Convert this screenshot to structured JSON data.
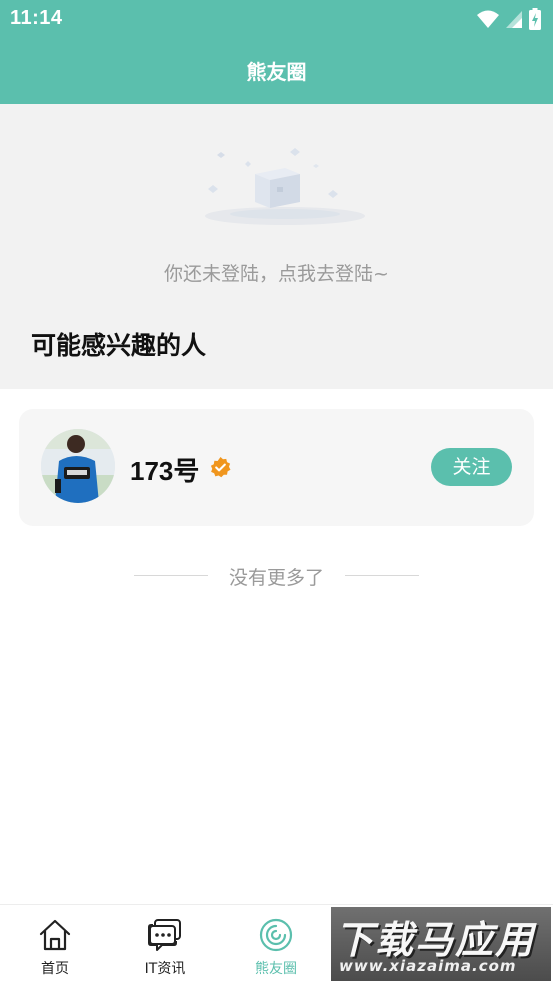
{
  "status_bar": {
    "time": "11:14"
  },
  "app_bar": {
    "title": "熊友圈"
  },
  "login_prompt": "你还未登陆，点我去登陆~",
  "section_title": "可能感兴趣的人",
  "suggested_user": {
    "name": "173号",
    "follow_label": "关注"
  },
  "no_more_text": "没有更多了",
  "bottom_nav": {
    "items": [
      {
        "label": "首页",
        "icon": "home-icon"
      },
      {
        "label": "IT资讯",
        "icon": "chat-icon"
      },
      {
        "label": "熊友圈",
        "icon": "circle-feed-icon",
        "active": true
      }
    ]
  },
  "watermark": {
    "title": "下载马应用",
    "url": "www.xiazaima.com"
  },
  "colors": {
    "accent": "#5bbfad",
    "verified": "#f0961e"
  }
}
